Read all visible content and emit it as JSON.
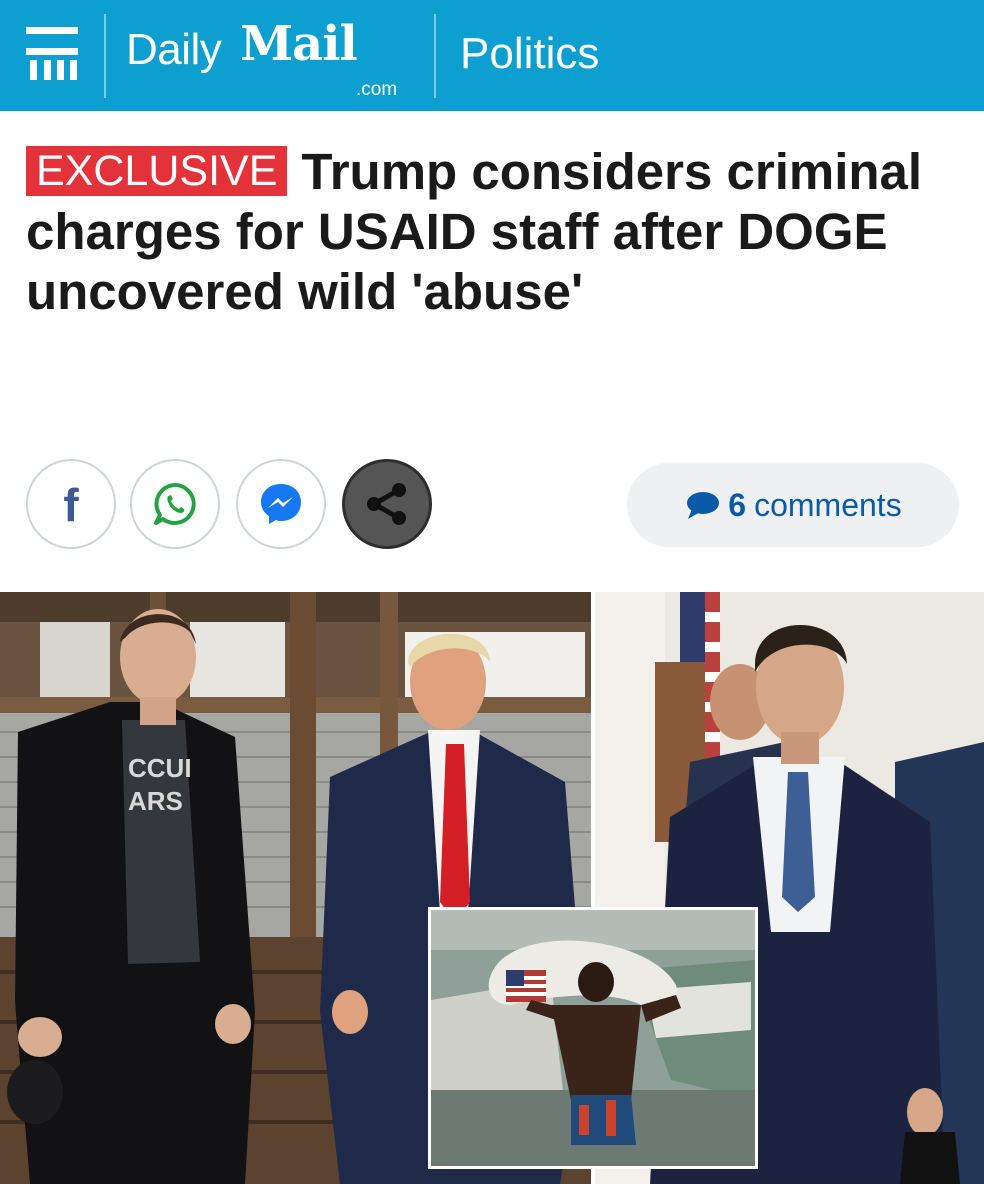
{
  "header": {
    "menu_icon": "hamburger-menu-icon",
    "logo": {
      "daily": "Daily",
      "mail": "Mail",
      "domain": ".com"
    },
    "section": "Politics",
    "background_color": "#0c9fcf"
  },
  "article": {
    "badge": "EXCLUSIVE",
    "badge_color": "#e4323a",
    "headline": "Trump considers criminal charges for USAID staff after DOGE uncovered wild 'abuse'"
  },
  "share": {
    "buttons": [
      {
        "icon": "facebook-icon"
      },
      {
        "icon": "whatsapp-icon"
      },
      {
        "icon": "messenger-icon"
      },
      {
        "icon": "share-icon"
      }
    ],
    "facebook_glyph": "f",
    "comments_count": "6",
    "comments_label": "comments",
    "comments_color": "#0b5aa8"
  },
  "images": {
    "main_left_shirt_line1": "CCUI",
    "main_left_shirt_line2": "ARS"
  }
}
